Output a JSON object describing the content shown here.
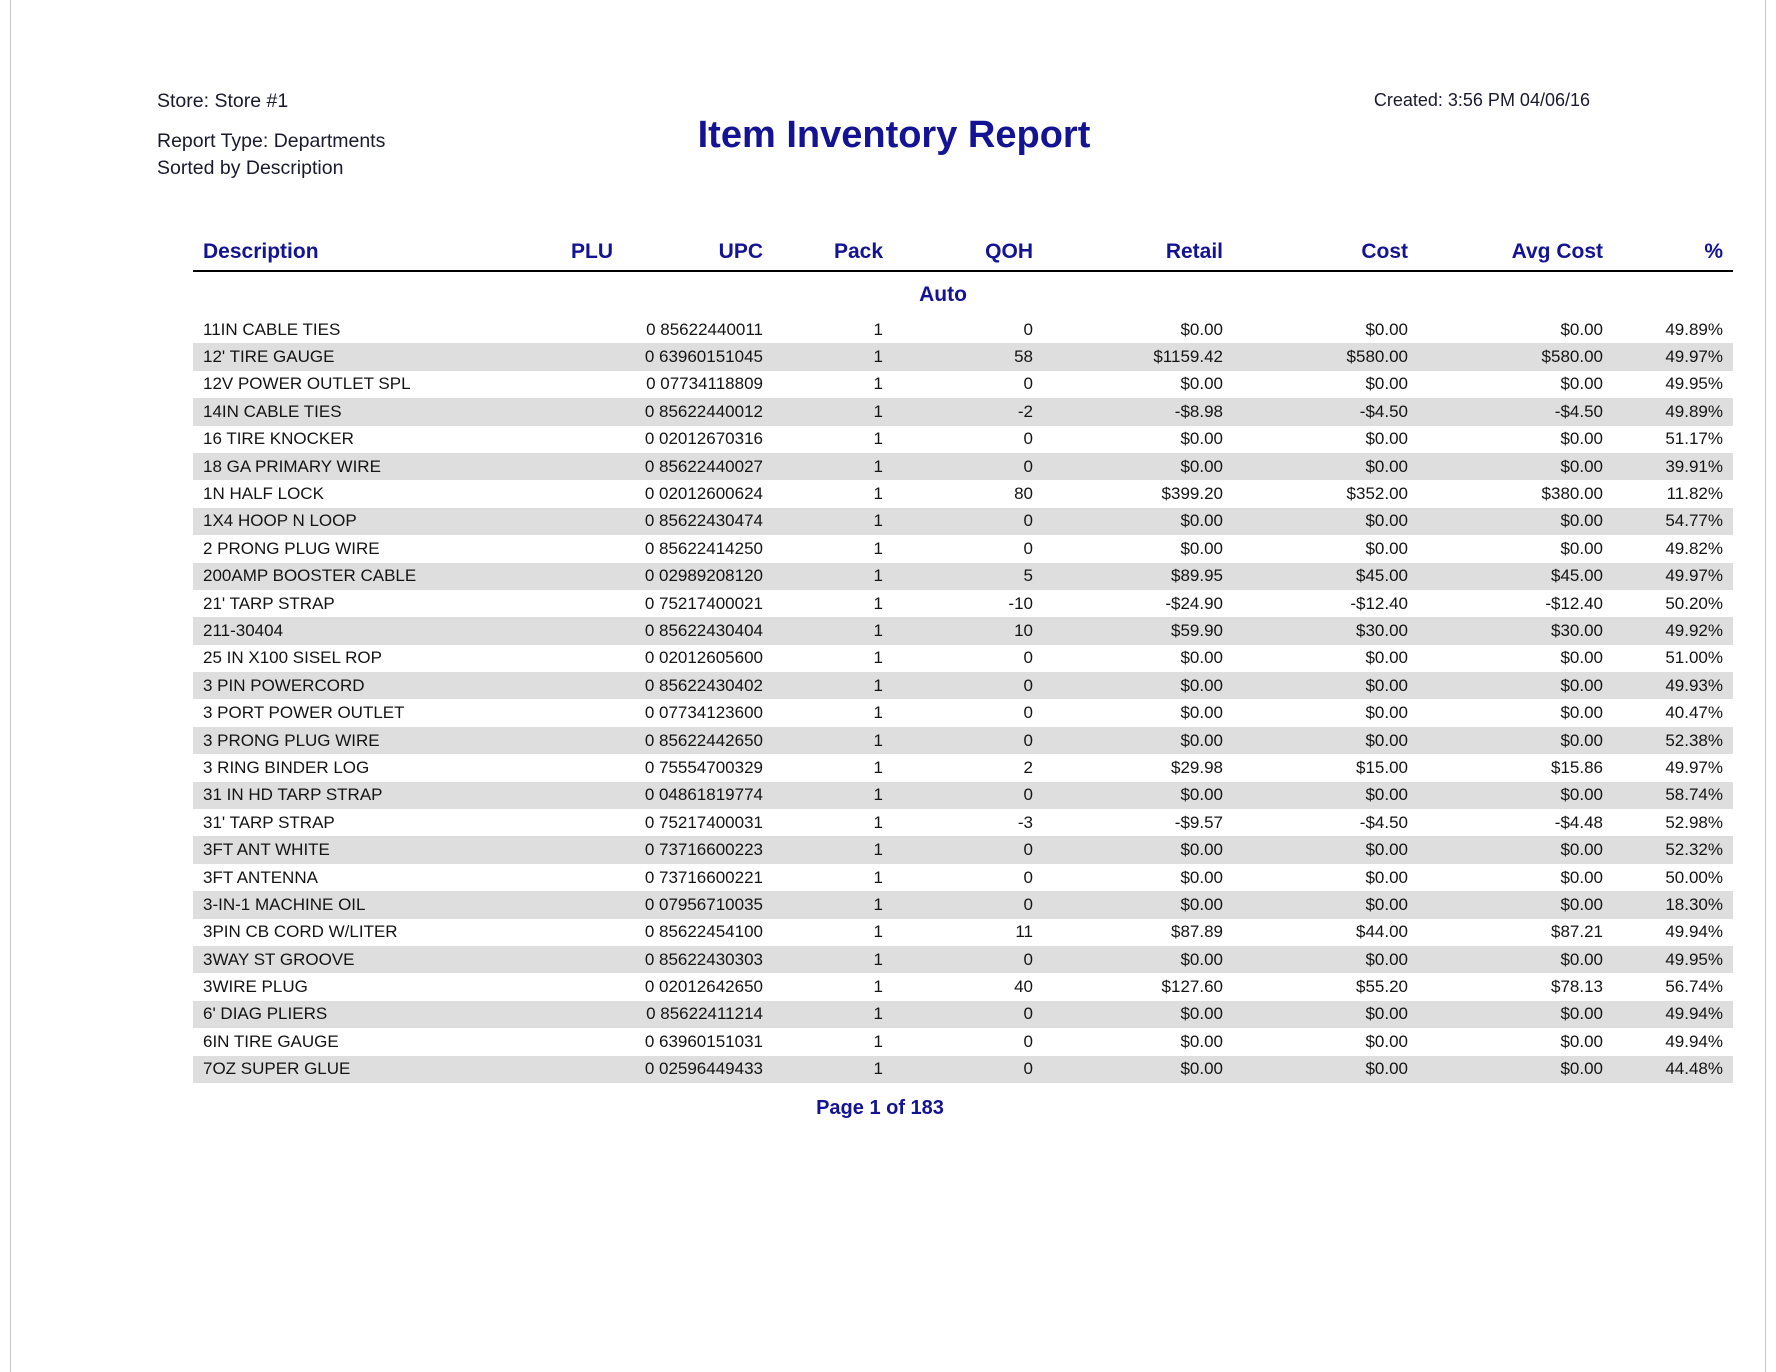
{
  "header": {
    "store_label": "Store: Store #1",
    "report_type_label": "Report Type: Departments",
    "sorted_by_label": "Sorted by Description",
    "created_label": "Created: 3:56 PM 04/06/16",
    "title": "Item Inventory Report"
  },
  "table": {
    "columns": [
      {
        "key": "description",
        "label": "Description"
      },
      {
        "key": "plu",
        "label": "PLU"
      },
      {
        "key": "upc",
        "label": "UPC"
      },
      {
        "key": "pack",
        "label": "Pack"
      },
      {
        "key": "qoh",
        "label": "QOH"
      },
      {
        "key": "retail",
        "label": "Retail"
      },
      {
        "key": "cost",
        "label": "Cost"
      },
      {
        "key": "avg_cost",
        "label": "Avg Cost"
      },
      {
        "key": "pct",
        "label": "%"
      }
    ],
    "group_label": "Auto",
    "rows": [
      {
        "description": "11IN CABLE TIES",
        "plu": "",
        "upc": "0 85622440011",
        "pack": "1",
        "qoh": "0",
        "retail": "$0.00",
        "cost": "$0.00",
        "avg_cost": "$0.00",
        "pct": "49.89%"
      },
      {
        "description": "12' TIRE GAUGE",
        "plu": "",
        "upc": "0 63960151045",
        "pack": "1",
        "qoh": "58",
        "retail": "$1159.42",
        "cost": "$580.00",
        "avg_cost": "$580.00",
        "pct": "49.97%"
      },
      {
        "description": "12V POWER OUTLET SPL",
        "plu": "",
        "upc": "0 07734118809",
        "pack": "1",
        "qoh": "0",
        "retail": "$0.00",
        "cost": "$0.00",
        "avg_cost": "$0.00",
        "pct": "49.95%"
      },
      {
        "description": "14IN CABLE TIES",
        "plu": "",
        "upc": "0 85622440012",
        "pack": "1",
        "qoh": "-2",
        "retail": "-$8.98",
        "cost": "-$4.50",
        "avg_cost": "-$4.50",
        "pct": "49.89%"
      },
      {
        "description": "16 TIRE KNOCKER",
        "plu": "",
        "upc": "0 02012670316",
        "pack": "1",
        "qoh": "0",
        "retail": "$0.00",
        "cost": "$0.00",
        "avg_cost": "$0.00",
        "pct": "51.17%"
      },
      {
        "description": "18 GA PRIMARY WIRE",
        "plu": "",
        "upc": "0 85622440027",
        "pack": "1",
        "qoh": "0",
        "retail": "$0.00",
        "cost": "$0.00",
        "avg_cost": "$0.00",
        "pct": "39.91%"
      },
      {
        "description": "1N HALF LOCK",
        "plu": "",
        "upc": "0 02012600624",
        "pack": "1",
        "qoh": "80",
        "retail": "$399.20",
        "cost": "$352.00",
        "avg_cost": "$380.00",
        "pct": "11.82%"
      },
      {
        "description": "1X4 HOOP N LOOP",
        "plu": "",
        "upc": "0 85622430474",
        "pack": "1",
        "qoh": "0",
        "retail": "$0.00",
        "cost": "$0.00",
        "avg_cost": "$0.00",
        "pct": "54.77%"
      },
      {
        "description": "2 PRONG PLUG WIRE",
        "plu": "",
        "upc": "0 85622414250",
        "pack": "1",
        "qoh": "0",
        "retail": "$0.00",
        "cost": "$0.00",
        "avg_cost": "$0.00",
        "pct": "49.82%"
      },
      {
        "description": "200AMP BOOSTER CABLE",
        "plu": "",
        "upc": "0 02989208120",
        "pack": "1",
        "qoh": "5",
        "retail": "$89.95",
        "cost": "$45.00",
        "avg_cost": "$45.00",
        "pct": "49.97%"
      },
      {
        "description": "21' TARP STRAP",
        "plu": "",
        "upc": "0 75217400021",
        "pack": "1",
        "qoh": "-10",
        "retail": "-$24.90",
        "cost": "-$12.40",
        "avg_cost": "-$12.40",
        "pct": "50.20%"
      },
      {
        "description": "211-30404",
        "plu": "",
        "upc": "0 85622430404",
        "pack": "1",
        "qoh": "10",
        "retail": "$59.90",
        "cost": "$30.00",
        "avg_cost": "$30.00",
        "pct": "49.92%"
      },
      {
        "description": "25 IN X100 SISEL ROP",
        "plu": "",
        "upc": "0 02012605600",
        "pack": "1",
        "qoh": "0",
        "retail": "$0.00",
        "cost": "$0.00",
        "avg_cost": "$0.00",
        "pct": "51.00%"
      },
      {
        "description": "3 PIN POWERCORD",
        "plu": "",
        "upc": "0 85622430402",
        "pack": "1",
        "qoh": "0",
        "retail": "$0.00",
        "cost": "$0.00",
        "avg_cost": "$0.00",
        "pct": "49.93%"
      },
      {
        "description": "3 PORT POWER OUTLET",
        "plu": "",
        "upc": "0 07734123600",
        "pack": "1",
        "qoh": "0",
        "retail": "$0.00",
        "cost": "$0.00",
        "avg_cost": "$0.00",
        "pct": "40.47%"
      },
      {
        "description": "3 PRONG PLUG WIRE",
        "plu": "",
        "upc": "0 85622442650",
        "pack": "1",
        "qoh": "0",
        "retail": "$0.00",
        "cost": "$0.00",
        "avg_cost": "$0.00",
        "pct": "52.38%"
      },
      {
        "description": "3 RING BINDER LOG",
        "plu": "",
        "upc": "0 75554700329",
        "pack": "1",
        "qoh": "2",
        "retail": "$29.98",
        "cost": "$15.00",
        "avg_cost": "$15.86",
        "pct": "49.97%"
      },
      {
        "description": "31 IN HD TARP STRAP",
        "plu": "",
        "upc": "0 04861819774",
        "pack": "1",
        "qoh": "0",
        "retail": "$0.00",
        "cost": "$0.00",
        "avg_cost": "$0.00",
        "pct": "58.74%"
      },
      {
        "description": "31' TARP STRAP",
        "plu": "",
        "upc": "0 75217400031",
        "pack": "1",
        "qoh": "-3",
        "retail": "-$9.57",
        "cost": "-$4.50",
        "avg_cost": "-$4.48",
        "pct": "52.98%"
      },
      {
        "description": "3FT ANT WHITE",
        "plu": "",
        "upc": "0 73716600223",
        "pack": "1",
        "qoh": "0",
        "retail": "$0.00",
        "cost": "$0.00",
        "avg_cost": "$0.00",
        "pct": "52.32%"
      },
      {
        "description": "3FT ANTENNA",
        "plu": "",
        "upc": "0 73716600221",
        "pack": "1",
        "qoh": "0",
        "retail": "$0.00",
        "cost": "$0.00",
        "avg_cost": "$0.00",
        "pct": "50.00%"
      },
      {
        "description": "3-IN-1 MACHINE OIL",
        "plu": "",
        "upc": "0 07956710035",
        "pack": "1",
        "qoh": "0",
        "retail": "$0.00",
        "cost": "$0.00",
        "avg_cost": "$0.00",
        "pct": "18.30%"
      },
      {
        "description": "3PIN CB CORD W/LITER",
        "plu": "",
        "upc": "0 85622454100",
        "pack": "1",
        "qoh": "11",
        "retail": "$87.89",
        "cost": "$44.00",
        "avg_cost": "$87.21",
        "pct": "49.94%"
      },
      {
        "description": "3WAY ST GROOVE",
        "plu": "",
        "upc": "0 85622430303",
        "pack": "1",
        "qoh": "0",
        "retail": "$0.00",
        "cost": "$0.00",
        "avg_cost": "$0.00",
        "pct": "49.95%"
      },
      {
        "description": "3WIRE PLUG",
        "plu": "",
        "upc": "0 02012642650",
        "pack": "1",
        "qoh": "40",
        "retail": "$127.60",
        "cost": "$55.20",
        "avg_cost": "$78.13",
        "pct": "56.74%"
      },
      {
        "description": "6' DIAG PLIERS",
        "plu": "",
        "upc": "0 85622411214",
        "pack": "1",
        "qoh": "0",
        "retail": "$0.00",
        "cost": "$0.00",
        "avg_cost": "$0.00",
        "pct": "49.94%"
      },
      {
        "description": "6IN TIRE GAUGE",
        "plu": "",
        "upc": "0 63960151031",
        "pack": "1",
        "qoh": "0",
        "retail": "$0.00",
        "cost": "$0.00",
        "avg_cost": "$0.00",
        "pct": "49.94%"
      },
      {
        "description": "7OZ SUPER GLUE",
        "plu": "",
        "upc": "0 02596449433",
        "pack": "1",
        "qoh": "0",
        "retail": "$0.00",
        "cost": "$0.00",
        "avg_cost": "$0.00",
        "pct": "44.48%"
      }
    ]
  },
  "footer": {
    "page_label": "Page 1 of 183"
  },
  "colors": {
    "accent": "#131394",
    "shaded_row": "#dedede",
    "text": "#141414"
  }
}
